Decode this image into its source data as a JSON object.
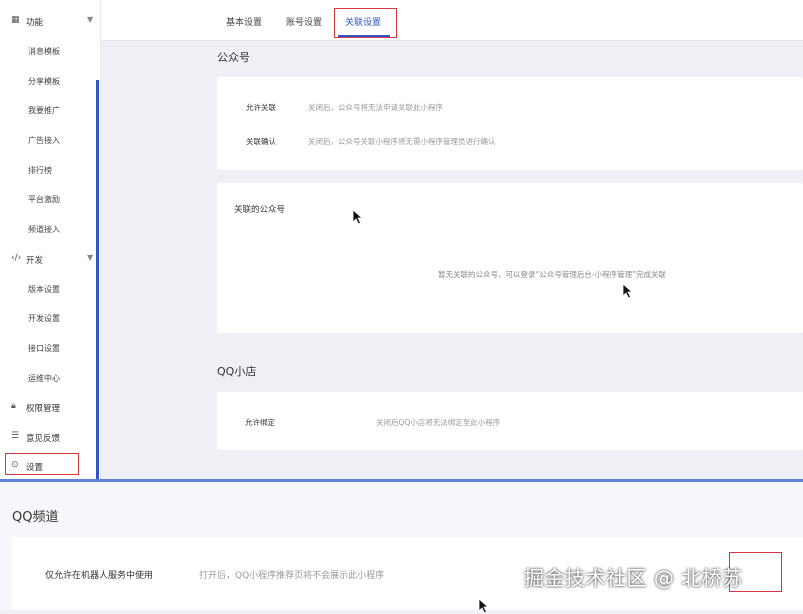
{
  "sidebar": {
    "sections": [
      {
        "icon": "grid-icon",
        "label": "功能",
        "items": [
          "消息模板",
          "分享模板",
          "我要推广",
          "广告接入",
          "排行榜",
          "平台激励",
          "频道接入"
        ]
      },
      {
        "icon": "code-icon",
        "label": "开发",
        "items": [
          "版本设置",
          "开发设置",
          "接口设置",
          "运维中心"
        ]
      }
    ],
    "permissions": "权限管理",
    "feedback": "意见反馈",
    "settings": "设置"
  },
  "tabs": [
    "基本设置",
    "账号设置",
    "关联设置"
  ],
  "official_account": {
    "title": "公众号",
    "rows": [
      {
        "label": "允许关联",
        "desc": "关闭后，公众号将无法申请关联此小程序"
      },
      {
        "label": "关联确认",
        "desc": "关闭后，公众号关联小程序将无需小程序管理员进行确认"
      }
    ],
    "linked_title": "关联的公众号",
    "empty_text": "暂无关联的公众号，可以登录“公众号管理后台-小程序管理”完成关联"
  },
  "qq_shop": {
    "title": "QQ小店",
    "row": {
      "label": "允许绑定",
      "desc": "关闭后QQ小店将无法绑定至此小程序"
    }
  },
  "qq_channel": {
    "title": "QQ频道",
    "row": {
      "label": "仅允许在机器人服务中使用",
      "desc": "打开后，QQ小程序推荐页将不会展示此小程序"
    }
  },
  "watermark": "掘金技术社区 @ 北桥苏",
  "colors": {
    "accent": "#2d57c8",
    "highlight": "#d9363e",
    "page_bg": "#eef0f5"
  }
}
